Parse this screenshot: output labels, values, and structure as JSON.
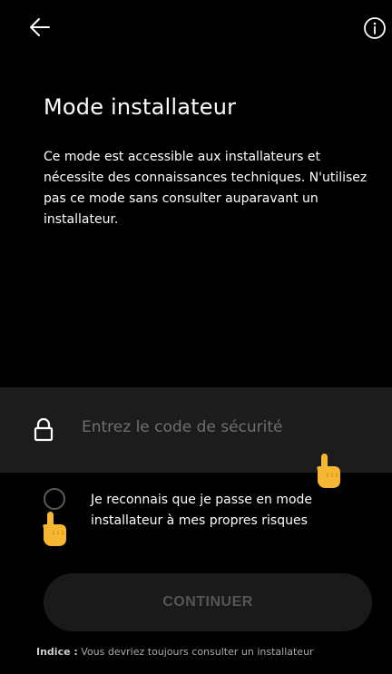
{
  "header": {
    "back_icon": "arrow-left-icon",
    "info_icon": "info-circle-icon"
  },
  "main": {
    "title": "Mode installateur",
    "description": "Ce mode est accessible aux installateurs et nécessite des connaissances techniques. N'utilisez pas ce mode sans consulter auparavant un installateur."
  },
  "security_code": {
    "icon": "lock-icon",
    "placeholder": "Entrez le code de sécurité"
  },
  "risk_acknowledgement": {
    "checked": false,
    "text": "Je reconnais que je passe en mode installateur à mes propres risques"
  },
  "continue_button": {
    "label": "CONTINUER",
    "enabled": false
  },
  "hint": {
    "label": "Indice :",
    "text": " Vous devriez toujours consulter un installateur"
  },
  "colors": {
    "background": "#000000",
    "field_background": "#1c1c1c",
    "button_background": "#1a1a1a",
    "placeholder_text": "#6f6f6f",
    "disabled_text": "#555555",
    "hand_icon": "#f7b733"
  }
}
